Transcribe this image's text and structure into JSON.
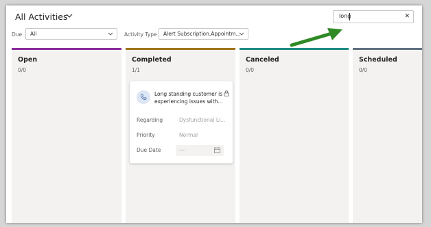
{
  "header": {
    "title": "All Activities"
  },
  "search": {
    "value": "long",
    "clear_glyph": "✕"
  },
  "filters": {
    "due": {
      "label": "Due",
      "value": "All"
    },
    "activity_type": {
      "label": "Activity Type",
      "value": "Alert Subscription,Appointm..."
    }
  },
  "colors": {
    "open": "#8a2d9c",
    "completed": "#a0741a",
    "canceled": "#1f8a83",
    "scheduled": "#607180",
    "arrow": "#2f8a26"
  },
  "columns": [
    {
      "title": "Open",
      "count": "0/0"
    },
    {
      "title": "Completed",
      "count": "1/1"
    },
    {
      "title": "Canceled",
      "count": "0/0"
    },
    {
      "title": "Scheduled",
      "count": "0/0"
    }
  ],
  "card": {
    "title_line1": "Long standing customer is",
    "title_line2": "experiencing issues with...",
    "icon": "phone-icon",
    "fields": {
      "regarding": {
        "label": "Regarding",
        "value": "Dysfunctional Li..."
      },
      "priority": {
        "label": "Priority",
        "value": "Normal"
      },
      "due_date": {
        "label": "Due Date",
        "value": "---"
      }
    }
  }
}
